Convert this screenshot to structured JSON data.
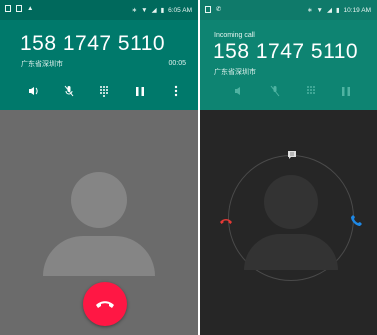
{
  "colors": {
    "header_dark": "#00796b",
    "header_light": "#0e8472",
    "end_call_red": "#ff1744",
    "decline_red": "#e53935",
    "answer_blue": "#1e88e5"
  },
  "left_screen": {
    "status_time": "6:05 AM",
    "phone_number": "158 1747 5110",
    "location": "广东省深圳市",
    "call_timer": "00:05",
    "controls": [
      "speaker-icon",
      "mute-icon",
      "dialpad-icon",
      "hold-icon",
      "more-icon"
    ],
    "end_call_icon": "phone-hangup-icon"
  },
  "right_screen": {
    "status_time": "10:19 AM",
    "status_label": "Incoming call",
    "phone_number": "158 1747 5110",
    "location": "广东省深圳市",
    "controls": [
      "speaker-icon",
      "mute-icon",
      "dialpad-icon",
      "hold-icon"
    ],
    "message_icon": "message-icon",
    "decline_icon": "phone-decline-icon",
    "answer_icon": "phone-answer-icon"
  }
}
